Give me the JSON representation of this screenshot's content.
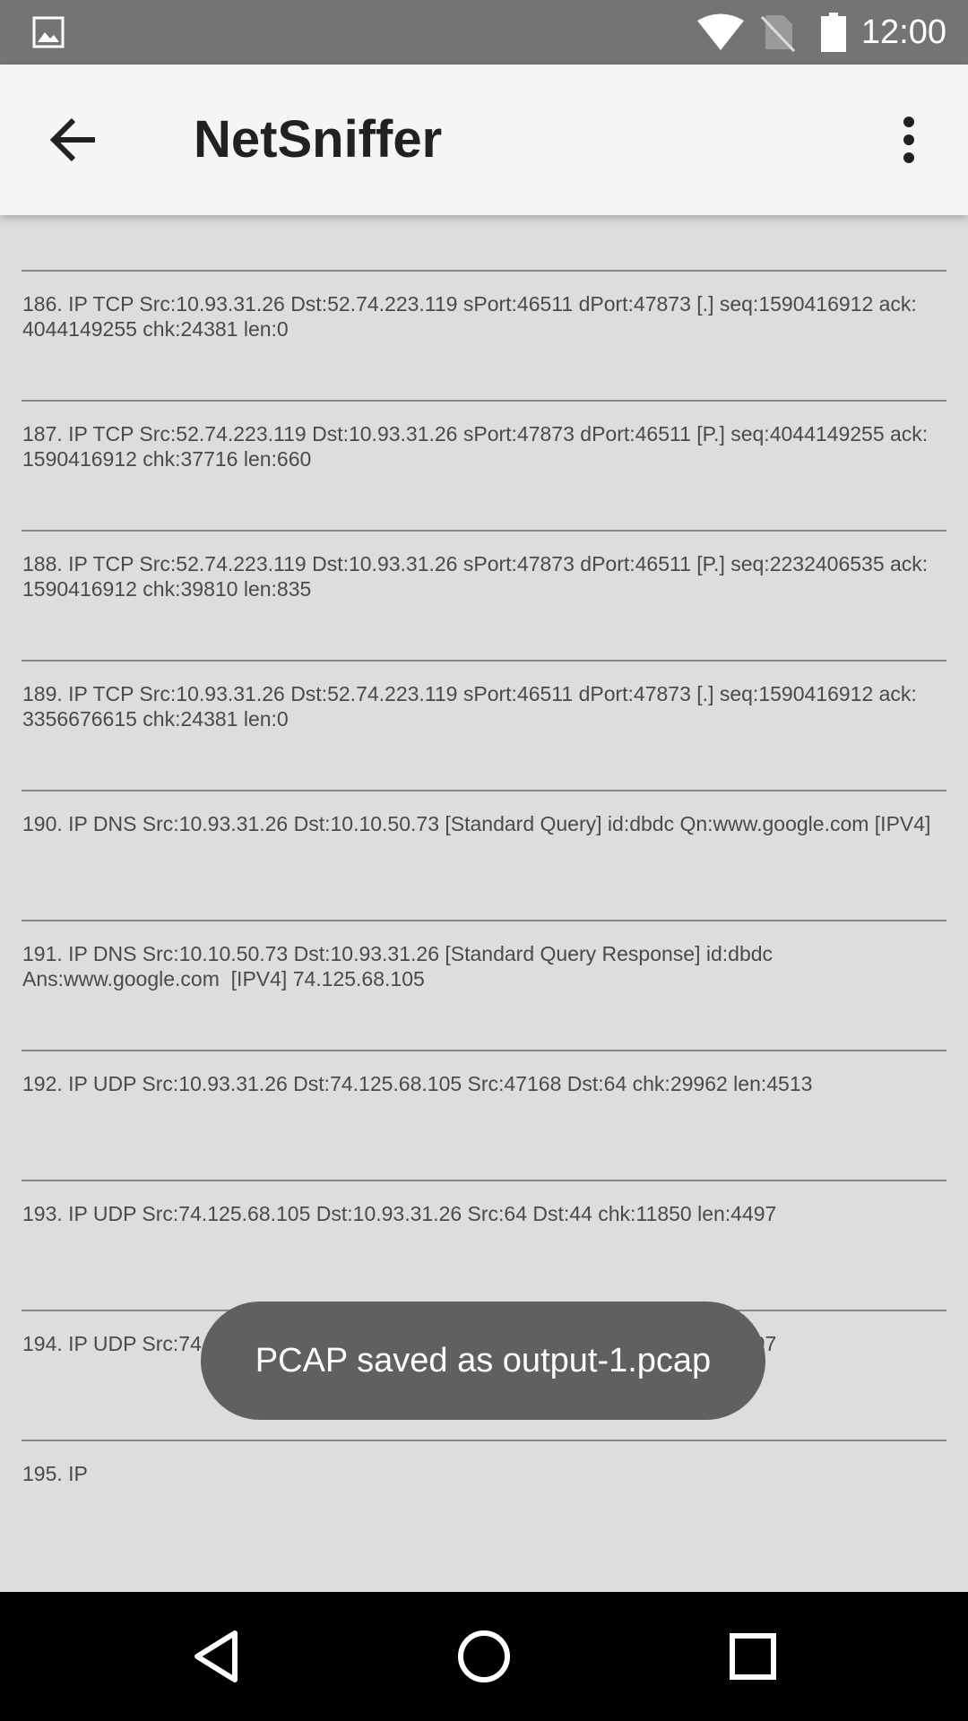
{
  "status_bar": {
    "time": "12:00",
    "icons": [
      "gallery-icon",
      "wifi-icon",
      "no-sim-icon",
      "battery-icon"
    ]
  },
  "app_bar": {
    "title": "NetSniffer",
    "back_icon": "arrow-back-icon",
    "menu_icon": "more-vert-icon"
  },
  "packets": [
    "186. IP TCP Src:10.93.31.26 Dst:52.74.223.119 sPort:46511 dPort:47873 [.] seq:1590416912 ack:\n4044149255 chk:24381 len:0",
    "187. IP TCP Src:52.74.223.119 Dst:10.93.31.26 sPort:47873 dPort:46511 [P.] seq:4044149255 ack:\n1590416912 chk:37716 len:660",
    "188. IP TCP Src:52.74.223.119 Dst:10.93.31.26 sPort:47873 dPort:46511 [P.] seq:2232406535 ack:\n1590416912 chk:39810 len:835",
    "189. IP TCP Src:10.93.31.26 Dst:52.74.223.119 sPort:46511 dPort:47873 [.] seq:1590416912 ack:\n3356676615 chk:24381 len:0",
    "190. IP DNS Src:10.93.31.26 Dst:10.10.50.73 [Standard Query] id:dbdc Qn:www.google.com [IPV4]",
    "191. IP DNS Src:10.10.50.73 Dst:10.93.31.26 [Standard Query Response] id:dbdc\nAns:www.google.com  [IPV4] 74.125.68.105",
    "192. IP UDP Src:10.93.31.26 Dst:74.125.68.105 Src:47168 Dst:64 chk:29962 len:4513",
    "193. IP UDP Src:74.125.68.105 Dst:10.93.31.26 Src:64 Dst:44 chk:11850 len:4497",
    "194. IP UDP Src:74.125.68.105 Dst:10.93.31.26 Src:64 Dst:44 chk:11850 len:4497",
    "195. IP"
  ],
  "toast": {
    "message": "PCAP saved as output-1.pcap"
  },
  "nav_bar": {
    "icons": [
      "nav-back-icon",
      "nav-home-icon",
      "nav-recents-icon"
    ]
  },
  "colors": {
    "status_bar": "#747474",
    "app_bar": "#f5f5f5",
    "content_bg": "#dddddd",
    "toast_bg": "#606060",
    "nav_bar": "#000000"
  }
}
